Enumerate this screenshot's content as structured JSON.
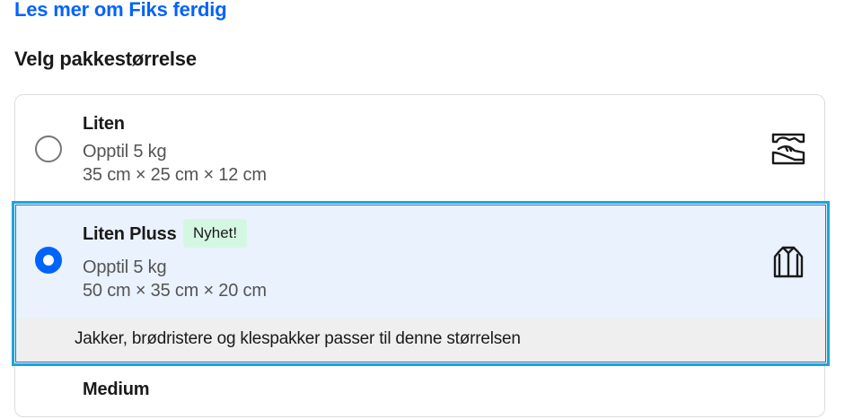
{
  "link": {
    "label": "Les mer om Fiks ferdig"
  },
  "heading": "Velg pakkestørrelse",
  "options": [
    {
      "title": "Liten",
      "weight": "Opptil 5 kg",
      "dimensions": "35 cm × 25 cm × 12 cm",
      "icon": "shoe-box-icon",
      "selected": false
    },
    {
      "title": "Liten Pluss",
      "badge": "Nyhet!",
      "weight": "Opptil 5 kg",
      "dimensions": "50 cm × 35 cm × 20 cm",
      "icon": "jacket-icon",
      "selected": true,
      "note": "Jakker, brødristere og klespakker passer til denne størrelsen"
    },
    {
      "title": "Medium"
    }
  ],
  "colors": {
    "link": "#0063fb",
    "radio_selected": "#0063fb",
    "selected_background": "#eaf2fd",
    "focus_ring": "#1aa6d9",
    "badge_background": "#d4f7e2",
    "note_background": "#efefef"
  }
}
